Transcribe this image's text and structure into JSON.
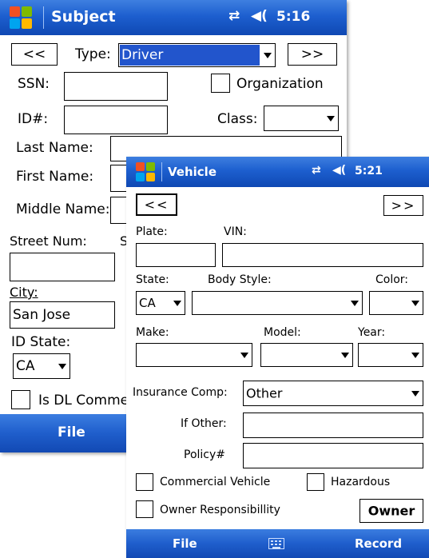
{
  "subject": {
    "title": "Subject",
    "time": "5:16",
    "nav_prev": "<<",
    "nav_next": ">>",
    "type_label": "Type:",
    "type_value": "Driver",
    "ssn_label": "SSN:",
    "organization_label": "Organization",
    "id_label": "ID#:",
    "class_label": "Class:",
    "last_name_label": "Last Name:",
    "first_name_label": "First Name:",
    "middle_name_label": "Middle Name:",
    "street_num_label": "Street Num:",
    "street_partial": "S",
    "city_label": "City:",
    "city_value": "San Jose",
    "id_state_label": "ID State:",
    "id_state_value": "CA",
    "dl_commercial_label": "Is DL Comme",
    "menu_file": "File"
  },
  "vehicle": {
    "title": "Vehicle",
    "time": "5:21",
    "nav_prev": "<<",
    "nav_next": ">>",
    "plate_label": "Plate:",
    "vin_label": "VIN:",
    "state_label": "State:",
    "state_value": "CA",
    "body_style_label": "Body Style:",
    "color_label": "Color:",
    "make_label": "Make:",
    "model_label": "Model:",
    "year_label": "Year:",
    "insurance_label": "Insurance Comp:",
    "insurance_value": "Other",
    "if_other_label": "If Other:",
    "policy_label": "Policy#",
    "commercial_label": "Commercial Vehicle",
    "hazardous_label": "Hazardous",
    "owner_resp_label": "Owner Responsibillity",
    "owner_button": "Owner",
    "menu_file": "File",
    "menu_record": "Record"
  },
  "icons": [
    "windows-start-icon",
    "connectivity-icon",
    "volume-icon",
    "keyboard-icon",
    "dropdown-arrow-icon"
  ],
  "colors": {
    "titlebar": "#1d5fcf",
    "selection": "#2255cc",
    "winflag": [
      "#f25022",
      "#7fba00",
      "#00a4ef",
      "#ffb900"
    ]
  }
}
